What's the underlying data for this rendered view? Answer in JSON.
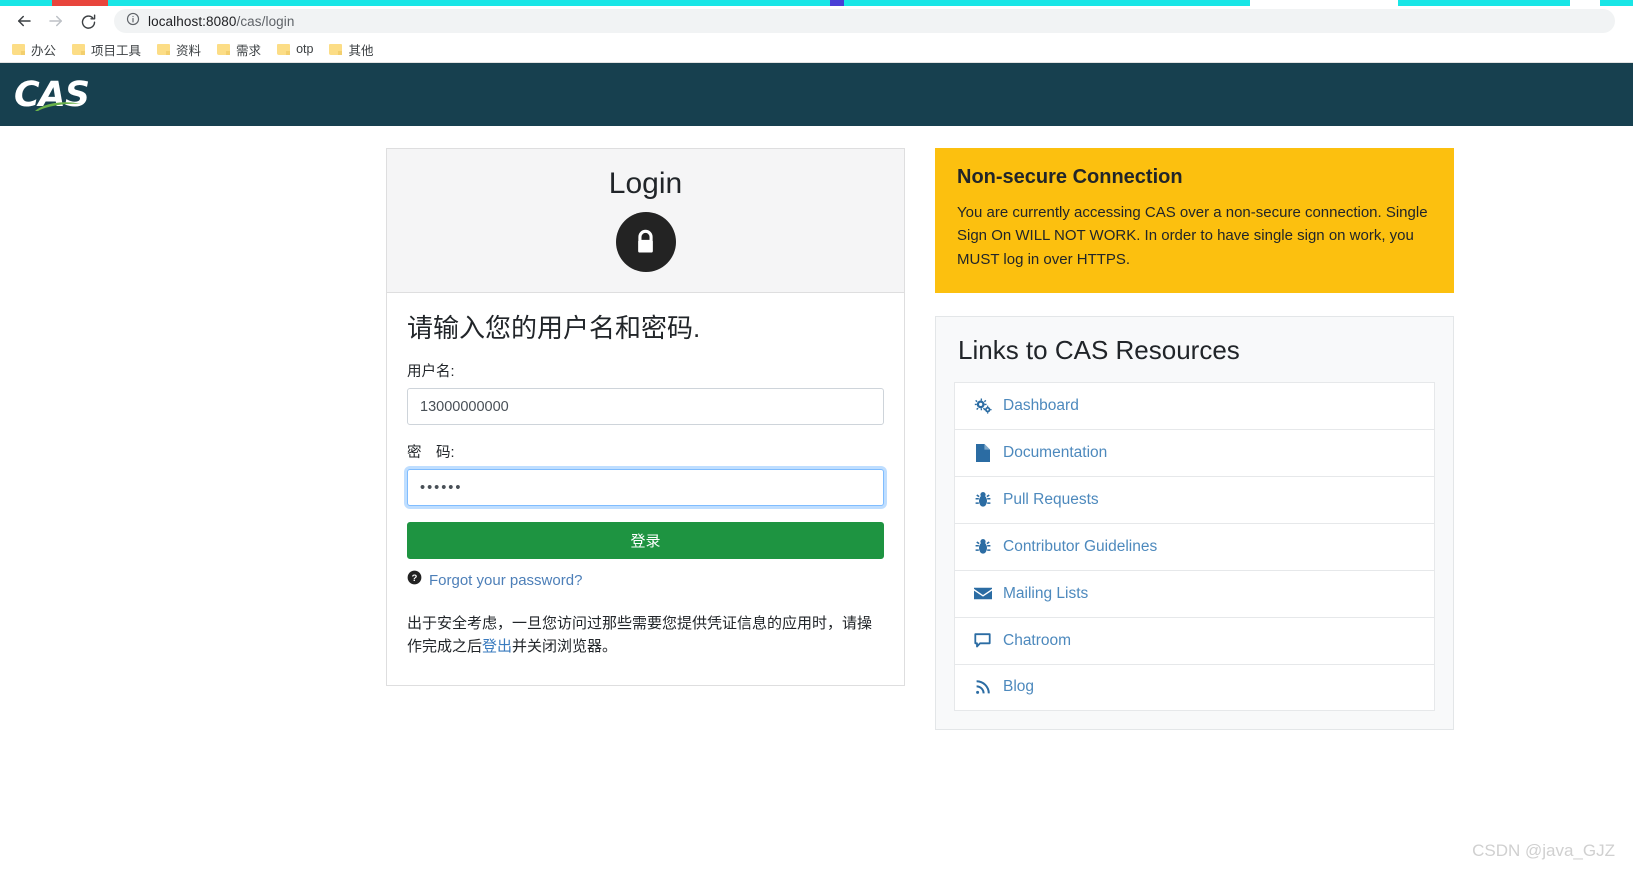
{
  "browser": {
    "url_prefix": "localhost:8080",
    "url_path": "/cas/login",
    "back_icon": "back-arrow-icon",
    "forward_icon": "forward-arrow-icon",
    "reload_icon": "reload-icon",
    "site_info_icon": "info-circle-icon",
    "bookmarks": [
      {
        "label": "办公",
        "icon": "folder-icon"
      },
      {
        "label": "项目工具",
        "icon": "folder-icon"
      },
      {
        "label": "资料",
        "icon": "folder-icon"
      },
      {
        "label": "需求",
        "icon": "folder-icon"
      },
      {
        "label": "otp",
        "icon": "folder-icon"
      },
      {
        "label": "其他",
        "icon": "folder-icon"
      }
    ]
  },
  "header": {
    "logo_text": "CAS",
    "background_color": "#17404f",
    "swoosh_color": "#6ab24a"
  },
  "login": {
    "title": "Login",
    "lock_icon": "lock-icon",
    "form_heading": "请输入您的用户名和密码.",
    "username_label": "用户名:",
    "username_value": "13000000000",
    "username_placeholder": "",
    "password_label": "密　码:",
    "password_value": "••••••",
    "password_placeholder": "",
    "submit_label": "登录",
    "submit_color": "#1e9441",
    "forgot_icon": "question-circle-icon",
    "forgot_label": "Forgot your password?",
    "security_note_part1": "出于安全考虑，一旦您访问过那些需要您提供凭证信息的应用时，请操作完成之后",
    "security_note_link": "登出",
    "security_note_part2": "并关闭浏览器。"
  },
  "warning": {
    "title": "Non-secure Connection",
    "text": "You are currently accessing CAS over a non-secure connection. Single Sign On WILL NOT WORK. In order to have single sign on work, you MUST log in over HTTPS.",
    "background_color": "#fcc00f"
  },
  "resources": {
    "title": "Links to CAS Resources",
    "link_color": "#4d89bd",
    "items": [
      {
        "label": "Dashboard",
        "icon": "cogs-icon"
      },
      {
        "label": "Documentation",
        "icon": "file-icon"
      },
      {
        "label": "Pull Requests",
        "icon": "bug-icon"
      },
      {
        "label": "Contributor Guidelines",
        "icon": "bug-icon"
      },
      {
        "label": "Mailing Lists",
        "icon": "envelope-icon"
      },
      {
        "label": "Chatroom",
        "icon": "comment-icon"
      },
      {
        "label": "Blog",
        "icon": "rss-icon"
      }
    ]
  },
  "watermark": {
    "text": "CSDN @java_GJZ"
  }
}
